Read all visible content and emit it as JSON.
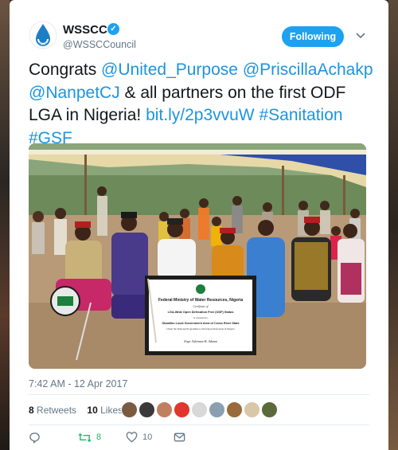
{
  "account": {
    "display_name": "WSSCC",
    "handle": "@WSSCCouncil",
    "verified_icon": "verified-badge-icon",
    "verified_glyph": "✓"
  },
  "follow_button": {
    "label": "Following"
  },
  "tweet": {
    "parts": [
      {
        "text": "Congrats ",
        "link": false
      },
      {
        "text": "@United_Purpose",
        "link": true
      },
      {
        "text": " ",
        "link": false
      },
      {
        "text": "@PriscillaAchakp",
        "link": true
      },
      {
        "text": " ",
        "link": false
      },
      {
        "text": "@NanpetCJ",
        "link": true
      },
      {
        "text": " & all partners on the first ODF LGA in Nigeria! ",
        "link": false
      },
      {
        "text": "bit.ly/2p3vvuW",
        "link": true
      },
      {
        "text": " ",
        "link": false
      },
      {
        "text": "#Sanitation",
        "link": true
      },
      {
        "text": " ",
        "link": false
      },
      {
        "text": "#GSF",
        "link": true
      }
    ],
    "link_color": "#1b95e0"
  },
  "photo": {
    "certificate": {
      "title": "Federal Ministry of Water Resources, Nigeria",
      "line1": "Certificate of",
      "line2": "LGA-Wide Open Defecation Free (ODF) Status",
      "line3": "is awarded to",
      "line4": "Obanliku Local Government Area of Cross River State",
      "line5": "Under the National Programme to End Open Defecation in Nigeria",
      "signature": "Engr. Suleiman H. Adamu"
    }
  },
  "meta": {
    "timestamp": "7:42 AM - 12 Apr 2017"
  },
  "stats": {
    "retweets_count": "8",
    "retweets_label": "Retweets",
    "likes_count": "10",
    "likes_label": "Likes"
  },
  "actions": {
    "retweet_count": "8",
    "like_count": "10"
  },
  "colors": {
    "accent": "#1da1f2",
    "retweet_green": "#17bf63",
    "muted": "#657786"
  }
}
